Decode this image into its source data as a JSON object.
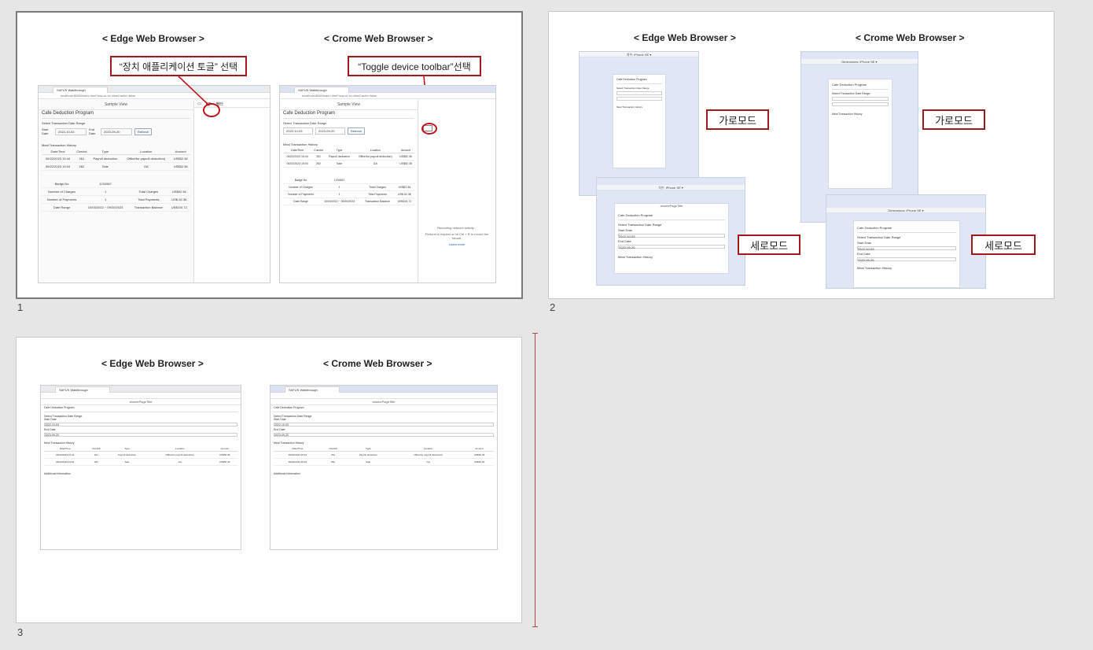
{
  "slides": [
    {
      "number": "1",
      "edge_heading": "< Edge Web Browser >",
      "chrome_heading": "< Crome Web Browser >",
      "edge_callout": "“장치 애플리케이션 토글” 선택",
      "chrome_callout": "“Toggle device toolbar”선택",
      "edge_shot": {
        "tab": "SAFUS Walkthrough",
        "url": "localhost:8080/index.html?sap-ui-xx-viewCache=false",
        "page_header": "Sample View",
        "app_title": "Cafe Deduction Program",
        "range_title": "Select Transaction Date Range",
        "start_label": "Start Date",
        "start_value": "2022-10-03",
        "end_label": "End Date",
        "end_value": "2023-09-20",
        "refresh": "Refresh",
        "history_title": "Meal Transaction History",
        "columns": [
          "Date/Time",
          "Check#",
          "Type",
          "Location",
          "Amount"
        ],
        "rows": [
          [
            "06/22/2023 15:44",
            "261",
            "Payroll deduction",
            "Office/for payroll deduction)",
            "US$52.36"
          ],
          [
            "06/22/2023 15:04",
            "262",
            "Sale",
            "GA",
            "US$52.36"
          ]
        ],
        "summary": [
          [
            "Badge No",
            "1234567",
            "",
            ""
          ],
          [
            "Number of Charges",
            "1",
            "Total Charges",
            "US$52.36"
          ],
          [
            "Number of Payments",
            "1",
            "Total Payments",
            "US$-52.36"
          ],
          [
            "Date Range",
            "10/03/2022 ~ 09/20/2023",
            "Transaction Balance",
            "US$104.72"
          ]
        ],
        "devtools": [
          "top",
          "필터"
        ]
      },
      "chrome_shot": {
        "tab": "SAFUS Walkthrough",
        "url": "localhost:8080/index.html?sap-ui-xx-viewCache=false",
        "page_header": "Sample View",
        "app_title": "Cafe Deduction Program",
        "range_title": "Select Transaction Date Range",
        "start_value": "2022-10-03",
        "end_value": "2023-09-20",
        "refresh": "Refresh",
        "history_title": "Meal Transaction History",
        "columns": [
          "Date/Time",
          "Check#",
          "Type",
          "Location",
          "Amount"
        ],
        "rows": [
          [
            "06/22/2023 15:44",
            "261",
            "Payroll deduction",
            "Office/for payroll deduction)",
            "US$52.36"
          ],
          [
            "06/22/2023 15:04",
            "262",
            "Sale",
            "GA",
            "US$52.36"
          ]
        ],
        "summary": [
          [
            "Badge No",
            "1234567",
            "",
            ""
          ],
          [
            "Number of Charges",
            "1",
            "Total Charges",
            "US$52.36"
          ],
          [
            "Number of Payments",
            "1",
            "Total Payments",
            "US$-52.36"
          ],
          [
            "Date Range",
            "10/03/2022 ~ 09/20/2023",
            "Transaction Balance",
            "US$104.72"
          ]
        ],
        "devtools_msg": "Recording network activity...",
        "devtools_msg2": "Perform a request or hit Ctrl + R to record the reload.",
        "learn_more": "Learn more"
      }
    },
    {
      "number": "2",
      "edge_heading": "< Edge Web Browser >",
      "chrome_heading": "< Crome Web Browser >",
      "landscape_label": "가로모드",
      "portrait_label": "세로모드",
      "app_title": "Cafe Deduction Program",
      "range_title": "Select Transaction Date Range",
      "history_title": "Meal Transaction History",
      "start_label": "Start Date",
      "end_label": "End Date",
      "start_value": "2022-10-03",
      "end_value": "2023-09-20",
      "page_header": "shomePageTitle",
      "device_edge": "치수: iPhone SE ▾",
      "device_chrome": "Dimensions: iPhone SE ▾"
    },
    {
      "number": "3",
      "edge_heading": "< Edge Web Browser >",
      "chrome_heading": "< Crome Web Browser >",
      "page_header": "shomePageTitle",
      "app_title": "Cafe Deduction Program",
      "range_title": "Select Transaction Date Range",
      "start_label": "Start Date",
      "end_label": "End Date",
      "start_value": "2022-10-03",
      "end_value": "2023-09-20",
      "history_title": "Meal Transaction History",
      "columns": [
        "Date/Time",
        "Check#",
        "Type",
        "Location",
        "Amount"
      ],
      "rows": [
        [
          "06/22/2023 15:44",
          "261",
          "Payroll deduction",
          "Office/for payroll deduction)",
          "US$52.36"
        ],
        [
          "06/22/2023 15:04",
          "262",
          "Sale",
          "GA",
          "US$52.36"
        ]
      ],
      "additional_title": "Additional Information"
    }
  ]
}
